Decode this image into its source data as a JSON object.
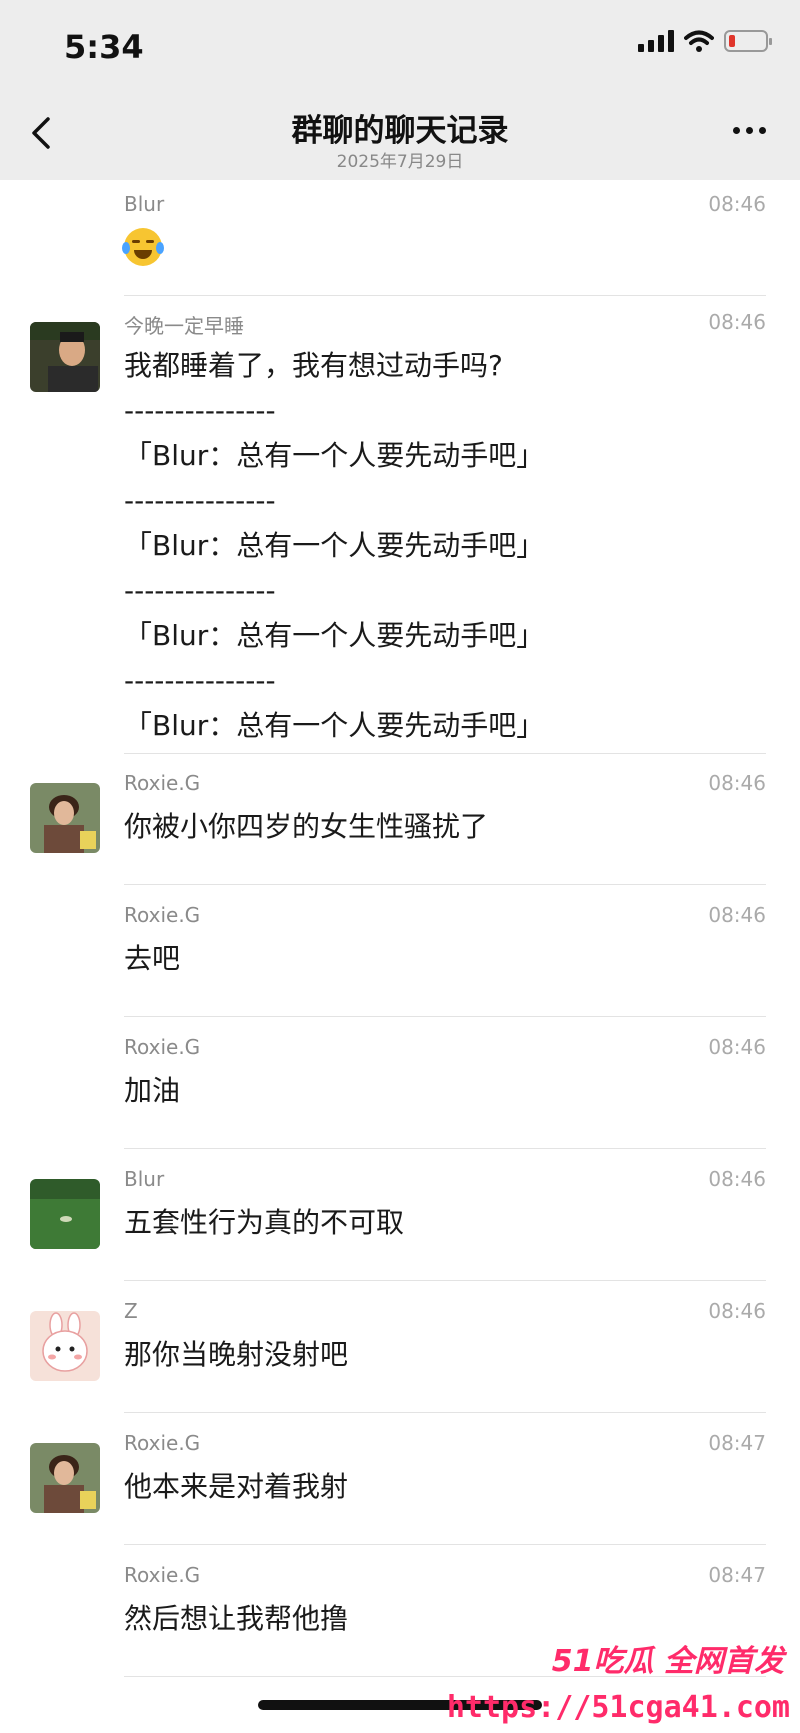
{
  "status_bar": {
    "time": "5:34"
  },
  "nav": {
    "title": "群聊的聊天记录",
    "subtitle": "2025年7月29日"
  },
  "messages": [
    {
      "sender": "Blur",
      "time": "08:46",
      "avatar": "none",
      "emoji": "crying-laughing-emoji"
    },
    {
      "sender": "今晚一定早睡",
      "time": "08:46",
      "avatar": "man-photo-avatar",
      "lines": [
        "我都睡着了，我有想过动手吗?",
        "---------------",
        "「Blur：总有一个人要先动手吧」",
        "---------------",
        "「Blur：总有一个人要先动手吧」",
        "---------------",
        "「Blur：总有一个人要先动手吧」",
        "---------------",
        "「Blur：总有一个人要先动手吧」"
      ]
    },
    {
      "sender": "Roxie.G",
      "time": "08:46",
      "avatar": "woman-photo-avatar",
      "text": "你被小你四岁的女生性骚扰了"
    },
    {
      "sender": "Roxie.G",
      "time": "08:46",
      "avatar": "none",
      "text": "去吧"
    },
    {
      "sender": "Roxie.G",
      "time": "08:46",
      "avatar": "none",
      "text": "加油"
    },
    {
      "sender": "Blur",
      "time": "08:46",
      "avatar": "green-field-avatar",
      "text": "五套性行为真的不可取"
    },
    {
      "sender": "Z",
      "time": "08:46",
      "avatar": "cartoon-bunny-avatar",
      "text": "那你当晚射没射吧"
    },
    {
      "sender": "Roxie.G",
      "time": "08:47",
      "avatar": "woman-photo-avatar",
      "text": "他本来是对着我射"
    },
    {
      "sender": "Roxie.G",
      "time": "08:47",
      "avatar": "none",
      "text": "然后想让我帮他撸"
    }
  ],
  "watermark": {
    "brand": "51吃瓜 全网首发",
    "url": "https://51cga41.com"
  },
  "colors": {
    "header_bg": "#ededed",
    "separator": "#e3e3e3",
    "watermark": "#ff2b6a"
  }
}
